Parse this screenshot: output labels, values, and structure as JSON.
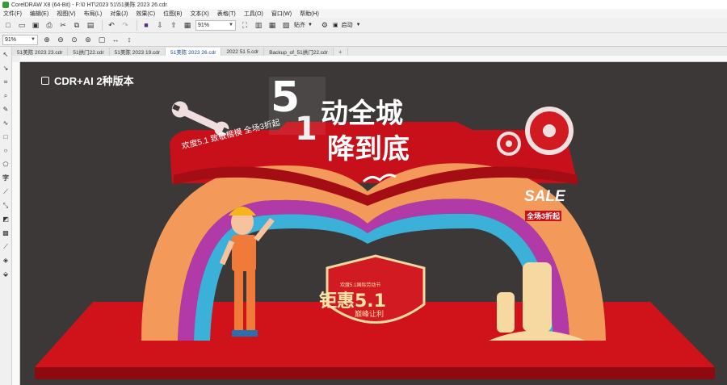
{
  "window": {
    "title": "CorelDRAW X8 (64-Bit) - F:\\0 HT\\2023 51\\51美陈 2023 26.cdr"
  },
  "menu": [
    "文件(F)",
    "编辑(E)",
    "视图(V)",
    "布局(L)",
    "对象(J)",
    "效果(C)",
    "位图(B)",
    "文本(X)",
    "表格(T)",
    "工具(O)",
    "窗口(W)",
    "帮助(H)"
  ],
  "toolbar": {
    "zoom_value": "91%",
    "paste_label": "贴齐",
    "launch_label": "启动"
  },
  "propbar": {
    "zoom_value": "91%"
  },
  "tabs": [
    "51美陈 2023 23.cdr",
    "51拱门22.cdr",
    "51美陈 2023 19.cdr",
    "51美陈 2023 26.cdr",
    "2022 51 5.cdr",
    "Backup_of_51拱门22.cdr",
    "+"
  ],
  "active_tab": 3,
  "canvas": {
    "watermark": "CDR+AI 2种版本",
    "headline_5": "5",
    "headline_1": "1",
    "headline_line1": "动全城",
    "headline_line2": "降到底",
    "slogan": "欢度5.1 致敬楷模 全场3折起",
    "sale": "SALE",
    "sale_sub": "全场3折起",
    "badge_top": "欢度5.1国际劳动节",
    "badge_main": "钜惠5.1",
    "badge_sub": "巅峰让利"
  },
  "colors": {
    "canvas_bg": "#3d3838",
    "platform_red": "#c8101a",
    "arch_orange": "#f39a5a",
    "arch_blue": "#3bb0d8",
    "arch_purple": "#b13aa8",
    "gold": "#f5d9a0"
  }
}
